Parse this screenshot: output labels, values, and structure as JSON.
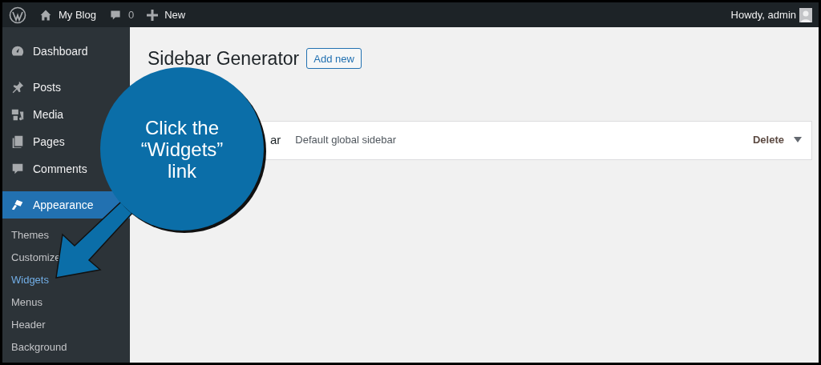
{
  "admin_bar": {
    "site_name": "My Blog",
    "comment_count": "0",
    "new_label": "New",
    "greeting": "Howdy, admin"
  },
  "sidebar": {
    "items": [
      {
        "label": "Dashboard",
        "kind": "dashboard",
        "selected": false
      },
      {
        "label": "Posts",
        "kind": "posts",
        "selected": false
      },
      {
        "label": "Media",
        "kind": "media",
        "selected": false
      },
      {
        "label": "Pages",
        "kind": "pages",
        "selected": false
      },
      {
        "label": "Comments",
        "kind": "comments",
        "selected": false
      },
      {
        "label": "Appearance",
        "kind": "appearance",
        "selected": true
      }
    ],
    "submenu": [
      {
        "label": "Themes",
        "selected": false
      },
      {
        "label": "Customize",
        "selected": false
      },
      {
        "label": "Widgets",
        "selected": true
      },
      {
        "label": "Menus",
        "selected": false
      },
      {
        "label": "Header",
        "selected": false
      },
      {
        "label": "Background",
        "selected": false
      }
    ]
  },
  "page": {
    "title": "Sidebar Generator",
    "add_button": "Add new",
    "sidebars": [
      {
        "name": "ar",
        "description": "Default global sidebar",
        "action": "Delete"
      }
    ]
  },
  "callout": {
    "lines": [
      "Click the",
      "“Widgets”",
      "link"
    ]
  }
}
